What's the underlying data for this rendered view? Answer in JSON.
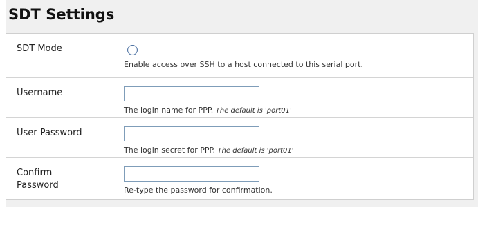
{
  "section": {
    "title": "SDT Settings"
  },
  "fields": [
    {
      "label": "SDT Mode",
      "type": "radio",
      "help": "Enable access over SSH to a host connected to this serial port.",
      "note": ""
    },
    {
      "label": "Username",
      "type": "text",
      "value": "",
      "help": "The login name for PPP. ",
      "note": "The default is 'port01'"
    },
    {
      "label": "User Password",
      "type": "password",
      "value": "",
      "help": "The login secret for PPP. ",
      "note": "The default is 'port01'"
    },
    {
      "label": "Confirm\nPassword",
      "label_lines": [
        "Confirm",
        "Password"
      ],
      "type": "password",
      "value": "",
      "help": "Re-type the password for confirmation.",
      "note": ""
    }
  ],
  "colors": {
    "panel_bg": "#f0f0f0",
    "row_bg": "#ffffff",
    "border": "#d4d4d4",
    "input_border": "#7f9db9"
  }
}
